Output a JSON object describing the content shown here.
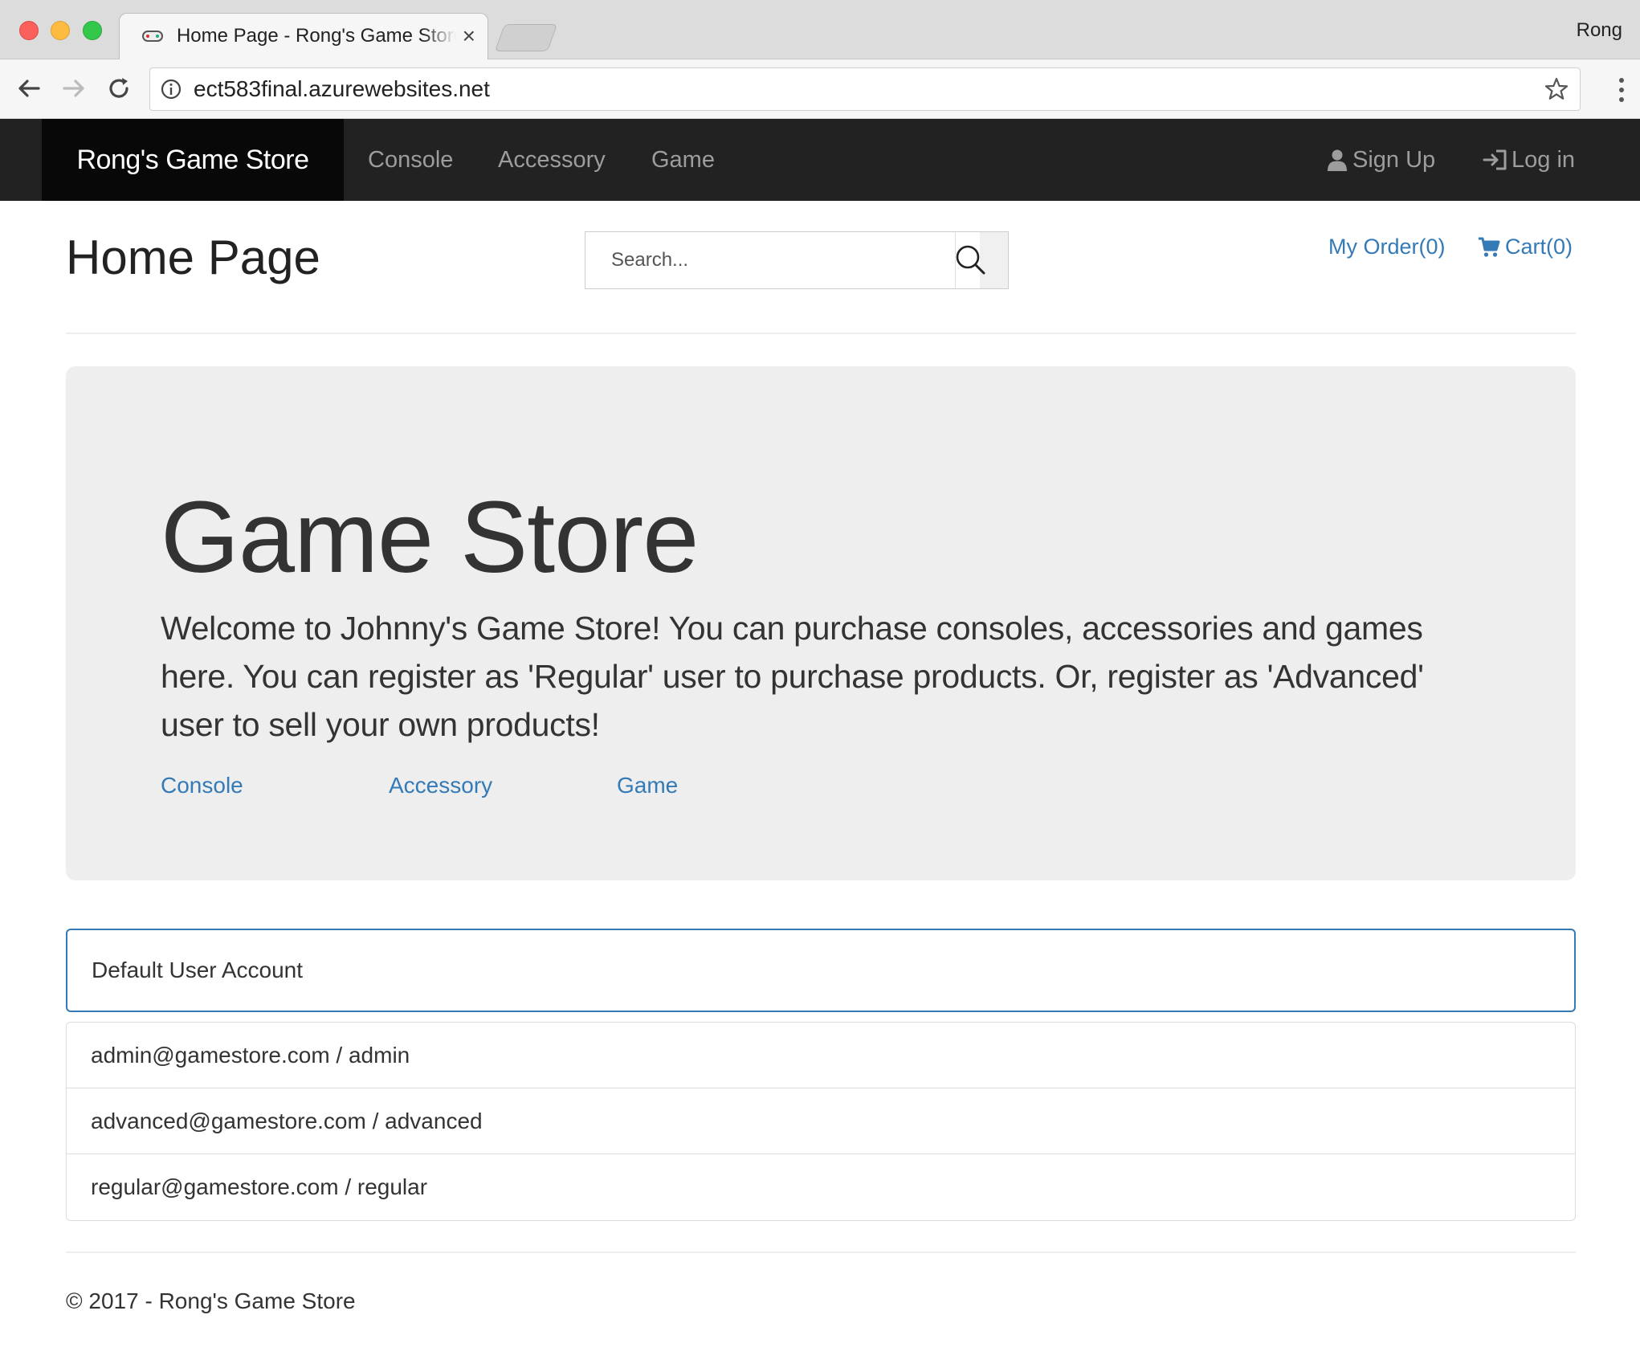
{
  "browser": {
    "tab_title": "Home Page - Rong's Game Store",
    "profile_name": "Rong",
    "url": "ect583final.azurewebsites.net"
  },
  "navbar": {
    "brand": "Rong's Game Store",
    "links": {
      "console": "Console",
      "accessory": "Accessory",
      "game": "Game"
    },
    "signup": "Sign Up",
    "login": "Log in"
  },
  "header": {
    "title": "Home Page",
    "search_placeholder": "Search...",
    "my_order": "My Order(0)",
    "cart": "Cart(0)"
  },
  "jumbotron": {
    "title": "Game Store",
    "text": "Welcome to Johnny's Game Store! You can purchase consoles, accessories and games here. You can register as 'Regular' user to purchase products. Or, register as 'Advanced' user to sell your own products!",
    "links": {
      "console": "Console",
      "accessory": "Accessory",
      "game": "Game"
    }
  },
  "accounts": {
    "heading": "Default User Account",
    "items": [
      "admin@gamestore.com / admin",
      "advanced@gamestore.com / advanced",
      "regular@gamestore.com / regular"
    ]
  },
  "footer": {
    "text": "© 2017 - Rong's Game Store"
  },
  "colors": {
    "link": "#337ab7",
    "navbar_bg": "#222222",
    "brand_bg": "#080808",
    "jumbotron_bg": "#eeeeee"
  },
  "icons": {
    "signup": "user-icon",
    "login": "log-in-icon",
    "cart": "shopping-cart-icon",
    "search": "search-icon"
  }
}
